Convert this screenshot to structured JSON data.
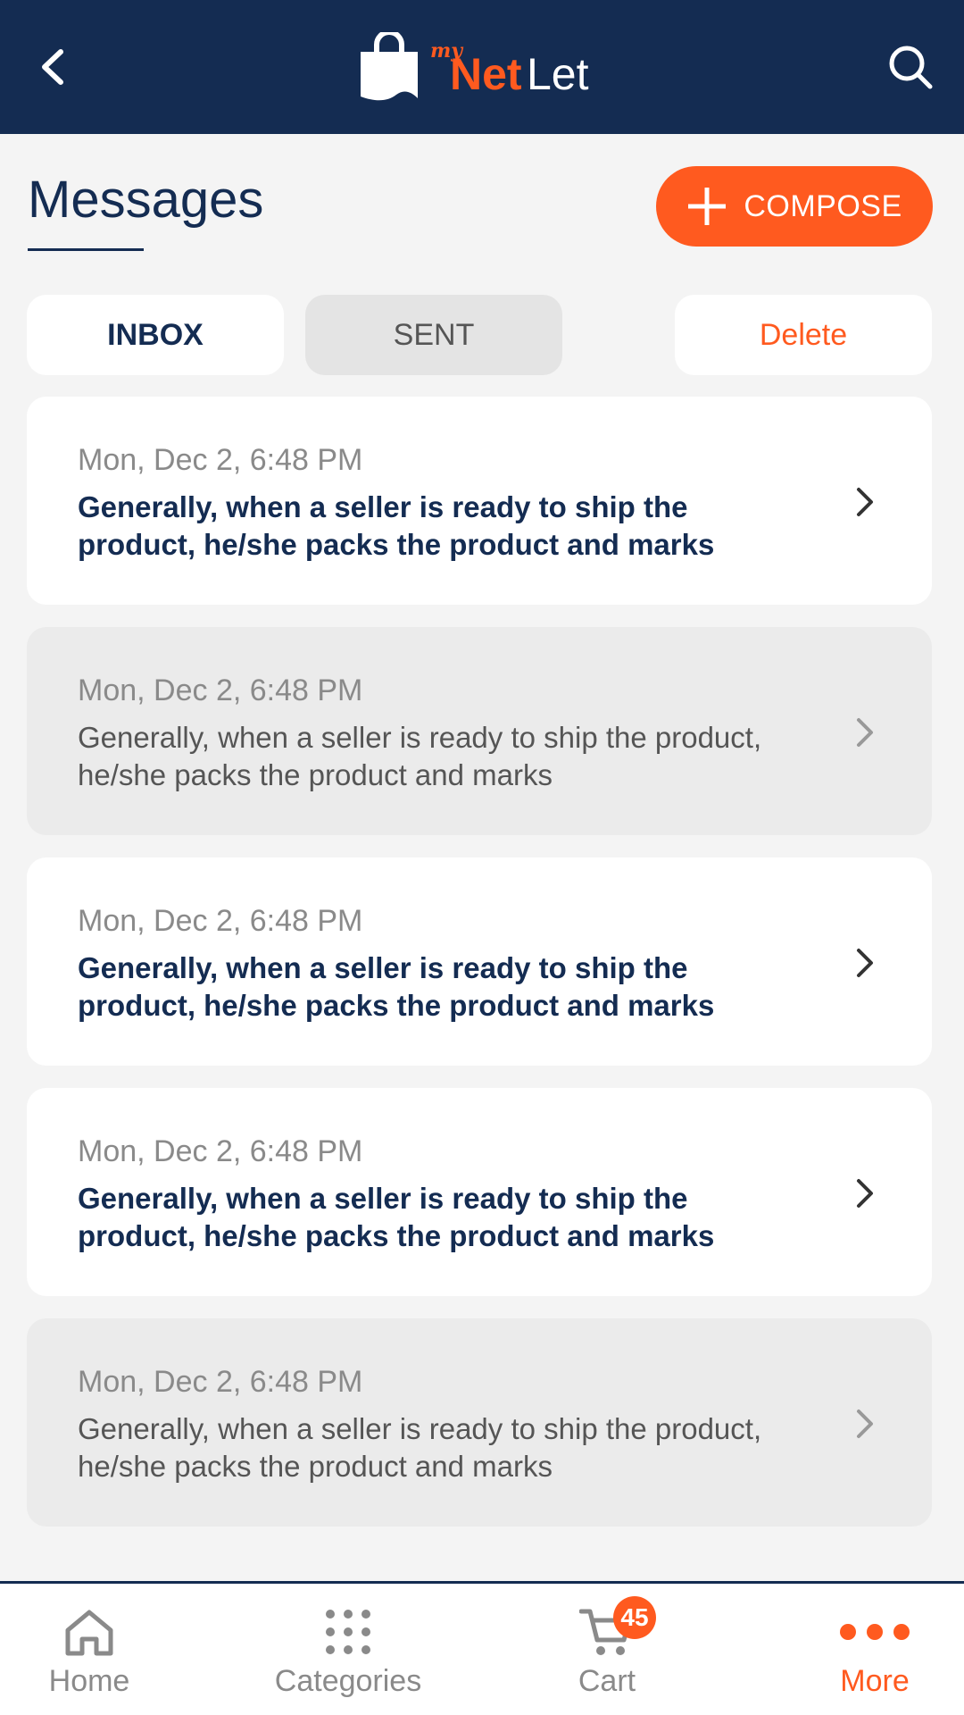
{
  "header": {
    "logo_my": "my",
    "logo_net": "Net",
    "logo_let": "Let",
    "icons": {
      "back": "chevron-left-icon",
      "search": "search-icon",
      "logo": "shopping-bag-icon"
    }
  },
  "page": {
    "title": "Messages",
    "compose_label": "COMPOSE"
  },
  "tabs": {
    "inbox": "INBOX",
    "sent": "SENT",
    "delete": "Delete",
    "active": "INBOX"
  },
  "messages": [
    {
      "date": "Mon, Dec 2, 6:48 PM",
      "body": "Generally, when a seller is ready to ship the product, he/she packs the product and marks",
      "unread": true
    },
    {
      "date": "Mon, Dec 2, 6:48 PM",
      "body": "Generally, when a seller is ready to ship the product, he/she packs the product and marks",
      "unread": false
    },
    {
      "date": "Mon, Dec 2, 6:48 PM",
      "body": "Generally, when a seller is ready to ship the product, he/she packs the product and marks",
      "unread": true
    },
    {
      "date": "Mon, Dec 2, 6:48 PM",
      "body": "Generally, when a seller is ready to ship the product, he/she packs the product and marks",
      "unread": true
    },
    {
      "date": "Mon, Dec 2, 6:48 PM",
      "body": "Generally, when a seller is ready to ship the product, he/she packs the product and marks",
      "unread": false
    }
  ],
  "bottom_nav": {
    "home": "Home",
    "categories": "Categories",
    "cart": "Cart",
    "cart_count": "45",
    "more": "More",
    "active": "More"
  },
  "colors": {
    "header_bg": "#142c52",
    "accent": "#ff5a1f",
    "background": "#f4f4f4"
  }
}
